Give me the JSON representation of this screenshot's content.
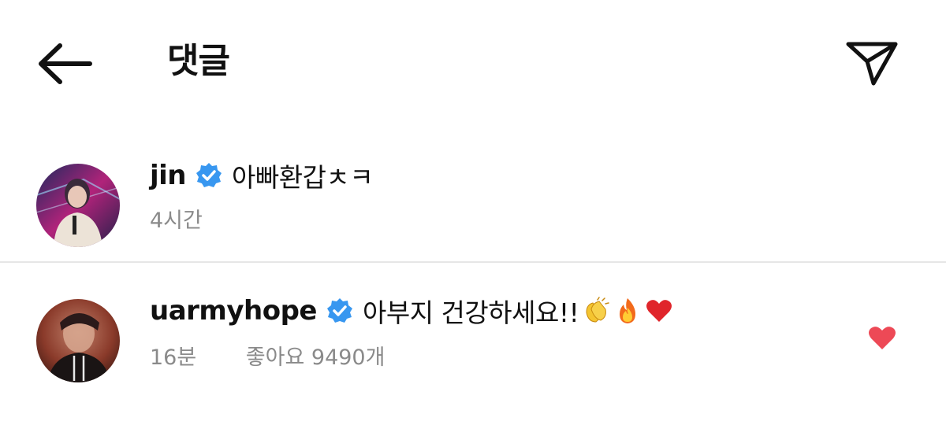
{
  "header": {
    "title": "댓글",
    "back_icon": "arrow-left-icon",
    "share_icon": "send-paper-plane-icon"
  },
  "comments": [
    {
      "username": "jin",
      "verified": true,
      "text": "아빠환갑ㅊㅋ",
      "time": "4시간",
      "emojis": []
    },
    {
      "username": "uarmyhope",
      "verified": true,
      "text": "아부지 건강하세요!!",
      "emojis": [
        "clapping-hands-emoji",
        "fire-emoji",
        "red-heart-emoji"
      ],
      "time": "16분",
      "likes": "좋아요 9490개",
      "liked": true
    }
  ],
  "colors": {
    "verified_blue": "#3897f0",
    "like_red": "#ed4956",
    "meta_gray": "#8a8a8a",
    "divider": "#e6e6e6"
  }
}
